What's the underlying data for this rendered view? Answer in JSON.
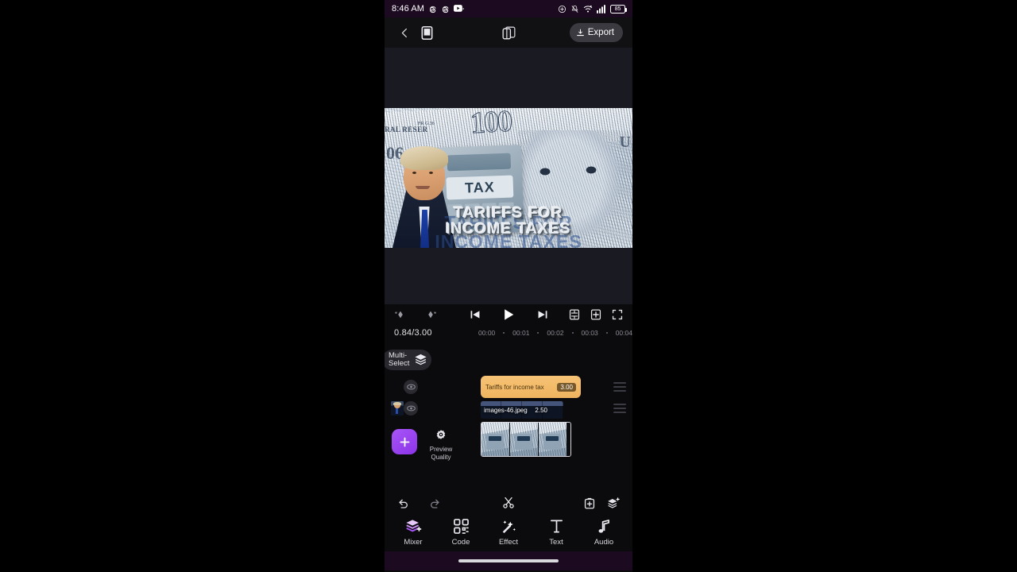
{
  "status_bar": {
    "time": "8:46 AM",
    "left_icons": [
      "threads-icon",
      "threads-icon",
      "youtube-icon"
    ],
    "right_icons": [
      "location-icon",
      "mute-icon",
      "wifi-icon",
      "signal-icon"
    ],
    "battery_level": "85",
    "background_color": "#1c0a20"
  },
  "top_bar": {
    "back_icon": "chevron-left-icon",
    "aspect_ratio_icon": "phone-frame-icon",
    "canvas_icon": "split-canvas-icon",
    "export_label": "Export",
    "export_icon": "download-icon",
    "export_bg": "#3a3a40"
  },
  "preview": {
    "background_color": "#1a1a22",
    "overlay_line_1": "TARIFFS FOR",
    "overlay_line_2": "INCOME TAXES",
    "ghost_line_1": "TARIFFS FOR",
    "ghost_line_2": "INCOME TAXES",
    "calculator_label": "TAX",
    "bill_denomination": "100",
    "bill_text_reserve": "RAL RESER",
    "bill_serial": "FR G 36",
    "bill_left_digits": "06",
    "bill_right_letter": "U"
  },
  "playback": {
    "prev_keyframe_icon": "prev-keyframe-icon",
    "next_keyframe_icon": "next-keyframe-icon",
    "skip_back_icon": "skip-back-icon",
    "play_icon": "play-icon",
    "skip_forward_icon": "skip-forward-icon",
    "align_icon": "align-icon",
    "add_frame_icon": "add-frame-icon",
    "fullscreen_icon": "fullscreen-icon",
    "current_time": "0.84/3.00",
    "ruler_ticks": [
      "00:00",
      "00:01",
      "00:02",
      "00:03",
      "00:04"
    ]
  },
  "timeline": {
    "multi_select_label": "Multi-Select",
    "multi_select_icon": "layers-icon",
    "eye_icon": "eye-icon",
    "add_media_icon": "plus-icon",
    "add_media_color": "#a855f7",
    "preview_quality_label": "Preview Quality",
    "preview_quality_icon": "quality-eye-icon",
    "drag_handle_icon": "drag-handle-icon",
    "tracks": [
      {
        "type": "text",
        "name": "Tariffs for  income tax",
        "duration": "3.00",
        "color": "#efb45f"
      },
      {
        "type": "image",
        "name": "images-46.jpeg",
        "duration": "2.50"
      },
      {
        "type": "video",
        "name": "",
        "duration": ""
      }
    ]
  },
  "tool_bar": {
    "undo_icon": "undo-icon",
    "redo_icon": "redo-icon",
    "split_icon": "scissors-icon",
    "add_clip_icon": "add-clip-icon",
    "layers_add_icon": "layers-add-icon"
  },
  "bottom_nav": {
    "items": [
      {
        "label": "Mixer",
        "icon": "mixer-layers-icon"
      },
      {
        "label": "Code",
        "icon": "code-qr-icon"
      },
      {
        "label": "Effect",
        "icon": "magic-wand-icon"
      },
      {
        "label": "Text",
        "icon": "text-t-icon"
      },
      {
        "label": "Audio",
        "icon": "music-note-icon"
      }
    ]
  }
}
